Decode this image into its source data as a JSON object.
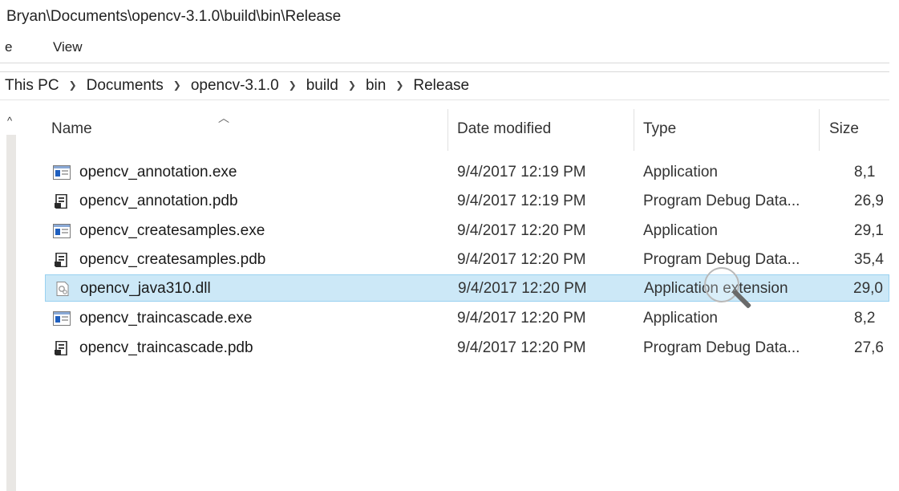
{
  "window": {
    "title_path": "Bryan\\Documents\\opencv-3.1.0\\build\\bin\\Release"
  },
  "ribbon": {
    "tabs": [
      {
        "label": "e"
      },
      {
        "label": "View"
      }
    ]
  },
  "breadcrumb": {
    "items": [
      "This PC",
      "Documents",
      "opencv-3.1.0",
      "build",
      "bin",
      "Release"
    ],
    "separator": ">"
  },
  "file_list": {
    "columns": {
      "name": "Name",
      "date": "Date modified",
      "type": "Type",
      "size": "Size"
    },
    "sorted_column": "name",
    "rows": [
      {
        "name": "opencv_annotation.exe",
        "date": "9/4/2017 12:19 PM",
        "type": "Application",
        "size": "8,1",
        "icon": "exe-icon"
      },
      {
        "name": "opencv_annotation.pdb",
        "date": "9/4/2017 12:19 PM",
        "type": "Program Debug Data...",
        "size": "26,9",
        "icon": "pdb-icon"
      },
      {
        "name": "opencv_createsamples.exe",
        "date": "9/4/2017 12:20 PM",
        "type": "Application",
        "size": "29,1",
        "icon": "exe-icon"
      },
      {
        "name": "opencv_createsamples.pdb",
        "date": "9/4/2017 12:20 PM",
        "type": "Program Debug Data...",
        "size": "35,4",
        "icon": "pdb-icon"
      },
      {
        "name": "opencv_java310.dll",
        "date": "9/4/2017 12:20 PM",
        "type": "Application extension",
        "size": "29,0",
        "icon": "dll-icon",
        "selected": true
      },
      {
        "name": "opencv_traincascade.exe",
        "date": "9/4/2017 12:20 PM",
        "type": "Application",
        "size": "8,2",
        "icon": "exe-icon"
      },
      {
        "name": "opencv_traincascade.pdb",
        "date": "9/4/2017 12:20 PM",
        "type": "Program Debug Data...",
        "size": "27,6",
        "icon": "pdb-icon"
      }
    ]
  },
  "colors": {
    "selection_bg": "#cce8f7",
    "selection_border": "#99d1f0",
    "exe_icon_blue": "#1f5fbf"
  }
}
